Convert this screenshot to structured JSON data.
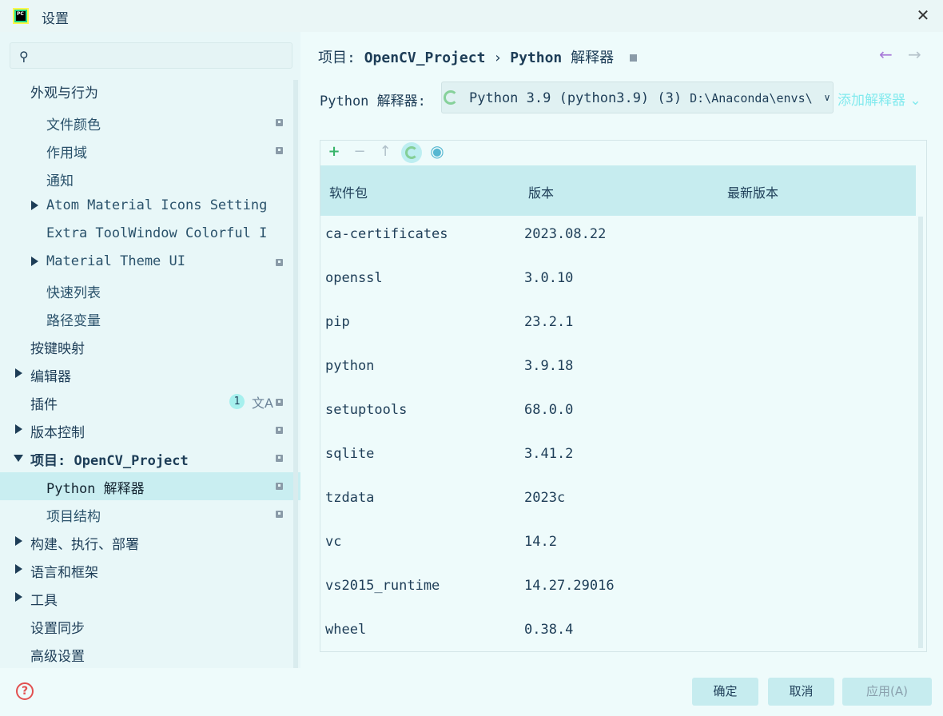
{
  "window": {
    "title": "设置",
    "app_logo_text": "PC"
  },
  "search": {
    "placeholder": "",
    "value": ""
  },
  "sidebar": {
    "items": [
      {
        "label": "外观与行为"
      },
      {
        "label": "文件颜色"
      },
      {
        "label": "作用域"
      },
      {
        "label": "通知"
      },
      {
        "label": "Atom Material Icons Setting"
      },
      {
        "label": "Extra ToolWindow Colorful I"
      },
      {
        "label": "Material Theme UI"
      },
      {
        "label": "快速列表"
      },
      {
        "label": "路径变量"
      },
      {
        "label": "按键映射"
      },
      {
        "label": "编辑器"
      },
      {
        "label": "插件",
        "badge": "1"
      },
      {
        "label": "版本控制"
      },
      {
        "label": "项目: OpenCV_Project"
      },
      {
        "label": "Python 解释器"
      },
      {
        "label": "项目结构"
      },
      {
        "label": "构建、执行、部署"
      },
      {
        "label": "语言和框架"
      },
      {
        "label": "工具"
      },
      {
        "label": "设置同步"
      },
      {
        "label": "高级设置"
      }
    ]
  },
  "breadcrumb": {
    "project_prefix": "项目: ",
    "project_name": "OpenCV_Project",
    "separator": "›",
    "page_python": "Python",
    "page_cn": "解释器"
  },
  "interpreter": {
    "label": "Python 解释器:",
    "selected_name": "Python 3.9 (python3.9) (3)",
    "selected_path": "D:\\Anaconda\\envs\\",
    "add_label": "添加解释器"
  },
  "packages": {
    "columns": [
      "软件包",
      "版本",
      "最新版本"
    ],
    "rows": [
      {
        "name": "ca-certificates",
        "version": "2023.08.22",
        "latest": ""
      },
      {
        "name": "openssl",
        "version": "3.0.10",
        "latest": ""
      },
      {
        "name": "pip",
        "version": "23.2.1",
        "latest": ""
      },
      {
        "name": "python",
        "version": "3.9.18",
        "latest": ""
      },
      {
        "name": "setuptools",
        "version": "68.0.0",
        "latest": ""
      },
      {
        "name": "sqlite",
        "version": "3.41.2",
        "latest": ""
      },
      {
        "name": "tzdata",
        "version": "2023c",
        "latest": ""
      },
      {
        "name": "vc",
        "version": "14.2",
        "latest": ""
      },
      {
        "name": "vs2015_runtime",
        "version": "14.27.29016",
        "latest": ""
      },
      {
        "name": "wheel",
        "version": "0.38.4",
        "latest": ""
      }
    ]
  },
  "footer": {
    "ok": "确定",
    "cancel": "取消",
    "apply": "应用(A)"
  },
  "icons": {
    "search": "search-icon",
    "close": "close-icon",
    "back": "arrow-left-icon",
    "forward": "arrow-right-icon",
    "add": "plus-icon",
    "remove": "minus-icon",
    "upgrade": "arrow-up-icon",
    "refresh": "refresh-icon",
    "show_early": "eye-icon",
    "help": "help-icon",
    "translate": "translate-icon"
  },
  "colors": {
    "accent": "#c6ecef",
    "add_green": "#38b46a",
    "back_purple": "#a77ad8",
    "add_interpreter_link": "#83eaee",
    "help_red": "#e25050"
  }
}
